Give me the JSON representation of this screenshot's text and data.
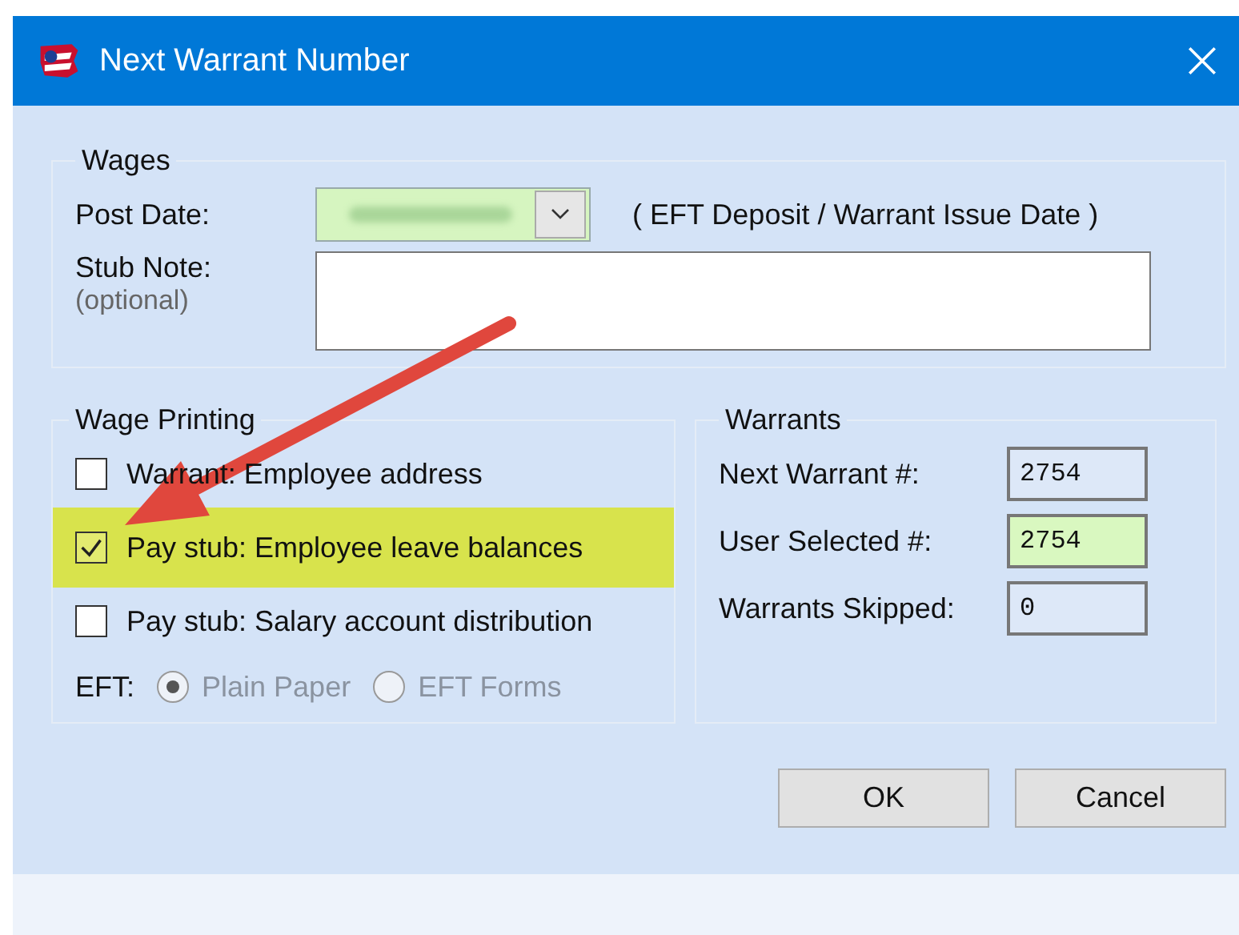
{
  "window": {
    "title": "Next Warrant Number"
  },
  "wages": {
    "title": "Wages",
    "post_date": {
      "label": "Post Date:",
      "highlighted": true,
      "blurred": true,
      "hint": "( EFT Deposit / Warrant Issue Date )"
    },
    "stub_note": {
      "label": "Stub Note:",
      "sublabel": "(optional)"
    }
  },
  "wage_printing": {
    "title": "Wage Printing",
    "options": [
      {
        "label": "Warrant:  Employee address",
        "checked": false,
        "highlighted": false
      },
      {
        "label": "Pay stub: Employee leave balances",
        "checked": true,
        "highlighted": true
      },
      {
        "label": "Pay stub: Salary account distribution",
        "checked": false,
        "highlighted": false
      }
    ],
    "eft": {
      "label": "EFT:",
      "disabled": true,
      "choices": [
        {
          "label": "Plain Paper",
          "selected": true
        },
        {
          "label": "EFT Forms",
          "selected": false
        }
      ]
    }
  },
  "warrants": {
    "title": "Warrants",
    "fields": [
      {
        "label": "Next Warrant #:",
        "value": "2754",
        "highlighted": false
      },
      {
        "label": "User Selected #:",
        "value": "2754",
        "highlighted": true
      },
      {
        "label": "Warrants Skipped:",
        "value": "0",
        "highlighted": false
      }
    ]
  },
  "buttons": [
    "OK",
    "Cancel"
  ]
}
